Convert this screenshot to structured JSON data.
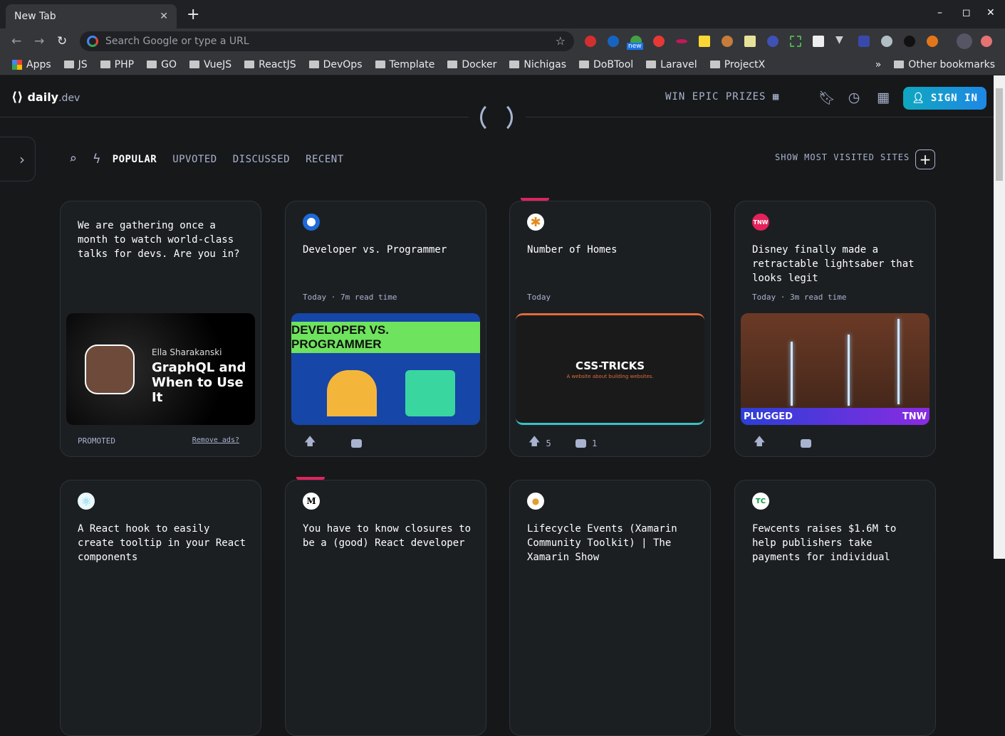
{
  "browser": {
    "tab_title": "New Tab",
    "omnibox_placeholder": "Search Google or type a URL",
    "extensions_badge": "new",
    "bookmarks": [
      "Apps",
      "JS",
      "PHP",
      "GO",
      "VueJS",
      "ReactJS",
      "DevOps",
      "Template",
      "Docker",
      "Nichigas",
      "DoBTool",
      "Laravel",
      "ProjectX"
    ],
    "more": "»",
    "other_bookmarks": "Other bookmarks"
  },
  "header": {
    "logo_main": "daily",
    "logo_suffix": ".dev",
    "prizes": "WIN EPIC PRIZES",
    "sign_in": "SIGN IN"
  },
  "filters": {
    "tabs": [
      "POPULAR",
      "UPVOTED",
      "DISCUSSED",
      "RECENT"
    ],
    "show_most_visited": "SHOW MOST VISITED SITES"
  },
  "colors": {
    "accent_signin": "#1e88e5",
    "flag": "#e0245e",
    "bg": "#17181a"
  },
  "cards": [
    {
      "title": "We are gathering once a month to watch world-class talks for devs. Are you in?",
      "image_speaker": "Ella Sharakanski",
      "image_title": "GraphQL and When to Use It",
      "promoted": "PROMOTED",
      "remove_ads": "Remove ads?"
    },
    {
      "title": "Developer vs. Programmer",
      "meta": "Today · 7m read time",
      "image_text": "DEVELOPER VS. PROGRAMMER",
      "upvotes": "",
      "comments": ""
    },
    {
      "title": "Number of Homes",
      "meta": "Today",
      "image_text": "CSS-TRICKS",
      "image_sub": "A website about building websites.",
      "upvotes": "5",
      "comments": "1"
    },
    {
      "title": "Disney finally made a retractable lightsaber that looks legit",
      "meta": "Today · 3m read time",
      "image_left": "PLUGGED",
      "image_right": "TNW",
      "source": "TNW"
    },
    {
      "title": "A React hook to easily create tooltip in your React components"
    },
    {
      "title": "You have to know closures to be a (good) React developer",
      "source": "M"
    },
    {
      "title": "Lifecycle Events (Xamarin Community Toolkit) | The Xamarin Show"
    },
    {
      "title": "Fewcents raises $1.6M to help publishers take payments for individual"
    }
  ]
}
